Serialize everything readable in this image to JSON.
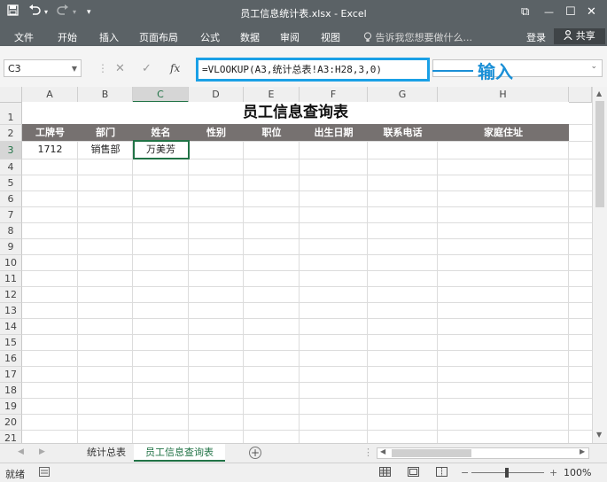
{
  "window": {
    "title": "员工信息统计表.xlsx - Excel",
    "save_icon": "save-icon",
    "undo_icon": "undo-icon",
    "redo_icon": "redo-icon",
    "qa_more": "▾",
    "ribbon_display_glyph": "⧉",
    "minimize_glyph": "—",
    "maximize_glyph": "☐",
    "close_glyph": "✕"
  },
  "ribbon": {
    "tabs": [
      "文件",
      "开始",
      "插入",
      "页面布局",
      "公式",
      "数据",
      "审阅",
      "视图"
    ],
    "tell_me": "告诉我您想要做什么...",
    "sign_in": "登录",
    "share": "共享"
  },
  "formula_bar": {
    "name_box": "C3",
    "cancel_glyph": "✕",
    "enter_glyph": "✓",
    "fx_glyph": "fx",
    "formula": "=VLOOKUP(A3,统计总表!A3:H28,3,0)",
    "annotation": "输入"
  },
  "sheet": {
    "columns": [
      "A",
      "B",
      "C",
      "D",
      "E",
      "F",
      "G",
      "H"
    ],
    "rows": [
      "1",
      "2",
      "3",
      "4",
      "5",
      "6",
      "7",
      "8",
      "9",
      "10",
      "11",
      "12",
      "13",
      "14",
      "15",
      "16",
      "17",
      "18",
      "19",
      "20",
      "21"
    ],
    "title": "员工信息查询表",
    "headers": [
      "工牌号",
      "部门",
      "姓名",
      "性别",
      "职位",
      "出生日期",
      "联系电话",
      "家庭住址"
    ],
    "row3": [
      "1712",
      "销售部",
      "万美芳"
    ],
    "active_cell": "C3"
  },
  "tabs": {
    "sheets": [
      "统计总表",
      "员工信息查询表"
    ],
    "active": "员工信息查询表",
    "add_glyph": "+"
  },
  "status": {
    "ready": "就绪",
    "zoom_minus": "−",
    "zoom_plus": "+",
    "zoom": "100%"
  },
  "colors": {
    "chrome": "#5b6266",
    "header_band": "#767170",
    "accent_green": "#217346",
    "annotation_blue": "#1a8fd6"
  }
}
